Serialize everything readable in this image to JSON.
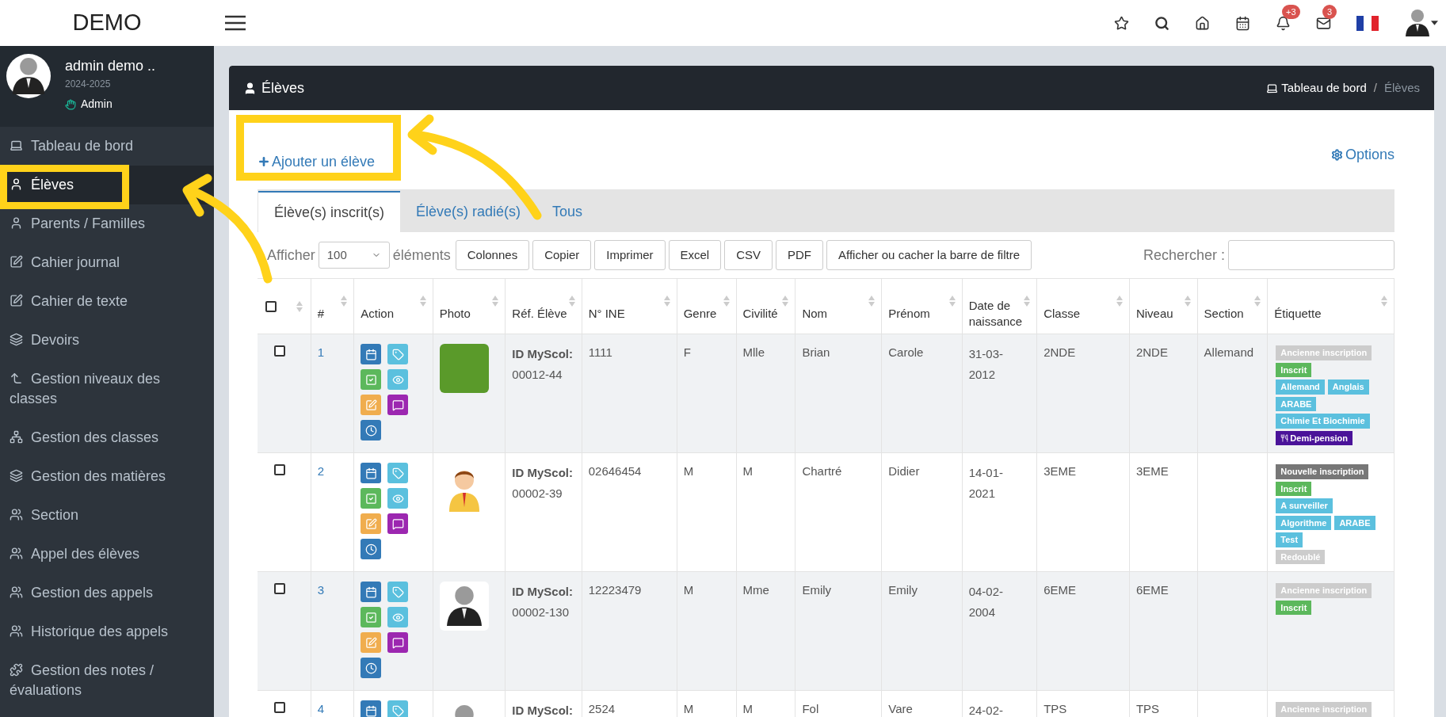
{
  "brand": "DEMO",
  "topbar": {
    "notifications_badge": "+3",
    "messages_badge": "3"
  },
  "profile": {
    "name": "admin demo ..",
    "year": "2024-2025",
    "role": "Admin"
  },
  "sidebar": {
    "items": [
      {
        "label": "Tableau de bord",
        "selected": false
      },
      {
        "label": "Élèves",
        "selected": true
      },
      {
        "label": "Parents / Familles",
        "selected": false
      },
      {
        "label": "Cahier journal",
        "selected": false
      },
      {
        "label": "Cahier de texte",
        "selected": false
      },
      {
        "label": "Devoirs",
        "selected": false
      },
      {
        "label": "Gestion niveaux des classes",
        "selected": false
      },
      {
        "label": "Gestion des classes",
        "selected": false
      },
      {
        "label": "Gestion des matières",
        "selected": false
      },
      {
        "label": "Section",
        "selected": false
      },
      {
        "label": "Appel des élèves",
        "selected": false
      },
      {
        "label": "Gestion des appels",
        "selected": false
      },
      {
        "label": "Historique des appels",
        "selected": false
      },
      {
        "label": "Gestion des notes / évaluations",
        "selected": false
      }
    ]
  },
  "page": {
    "title": "Élèves",
    "breadcrumb": [
      "Tableau de bord",
      "Élèves"
    ],
    "breadcrumb_separator": "/"
  },
  "add_button": "Ajouter un élève",
  "options_link": "Options",
  "tabs": [
    {
      "label": "Élève(s) inscrit(s)",
      "selected": true
    },
    {
      "label": "Élève(s) radié(s)",
      "selected": false
    },
    {
      "label": "Tous",
      "selected": false
    }
  ],
  "length_control": {
    "label_before": "Afficher",
    "value": "100",
    "label_after": "éléments"
  },
  "export_buttons": [
    "Colonnes",
    "Copier",
    "Imprimer",
    "Excel",
    "CSV",
    "PDF",
    "Afficher ou cacher la barre de filtre"
  ],
  "search": {
    "label": "Rechercher :"
  },
  "table": {
    "select_all_checked": false,
    "columns": [
      "#",
      "Action",
      "Photo",
      "Réf. Élève",
      "N° INE",
      "Genre",
      "Civilité",
      "Nom",
      "Prénom",
      "Date de naissance",
      "Classe",
      "Niveau",
      "Section",
      "Étiquette"
    ],
    "rows": [
      {
        "checked": false,
        "number": "1",
        "photo": {
          "kind": "photo"
        },
        "ref_label": "ID MyScol:",
        "ref": "00012-44",
        "ine": "1111",
        "genre": "F",
        "civilite": "Mlle",
        "nom": "Brian",
        "prenom": "Carole",
        "date": "31-03-2012",
        "classe": "2NDE",
        "niveau": "2NDE",
        "section": "Allemand",
        "tags": [
          [
            {
              "label": "Ancienne inscription",
              "color": "#cccccc"
            }
          ],
          [
            {
              "label": "Inscrit",
              "color": "#5cb85c"
            }
          ],
          [
            {
              "label": "Allemand",
              "color": "#5bc0de"
            },
            {
              "label": "Anglais",
              "color": "#5bc0de"
            }
          ],
          [
            {
              "label": "ARABE",
              "color": "#5bc0de"
            }
          ],
          [
            {
              "label": "Chimie Et Biochimie",
              "color": "#5bc0de"
            }
          ],
          [
            {
              "label": "Demi-pension",
              "color": "#4a1399",
              "kind": "meal"
            }
          ]
        ]
      },
      {
        "checked": false,
        "number": "2",
        "photo": {
          "kind": "cartoon"
        },
        "ref_label": "ID MyScol:",
        "ref": "00002-39",
        "ine": "02646454",
        "genre": "M",
        "civilite": "M",
        "nom": "Chartré",
        "prenom": "Didier",
        "date": "14-01-2021",
        "classe": "3EME",
        "niveau": "3EME",
        "section": "",
        "tags": [
          [
            {
              "label": "Nouvelle inscription",
              "color": "#777777"
            }
          ],
          [
            {
              "label": "Inscrit",
              "color": "#5cb85c"
            }
          ],
          [
            {
              "label": "A surveiller",
              "color": "#5bc0de"
            }
          ],
          [
            {
              "label": "Algorithme",
              "color": "#5bc0de"
            },
            {
              "label": "ARABE",
              "color": "#5bc0de"
            }
          ],
          [
            {
              "label": "Test",
              "color": "#5bc0de"
            }
          ],
          [
            {
              "label": "Redoublé",
              "color": "#cccccc"
            }
          ]
        ]
      },
      {
        "checked": false,
        "number": "3",
        "photo": {
          "kind": "avatar"
        },
        "ref_label": "ID MyScol:",
        "ref": "00002-130",
        "ine": "12223479",
        "genre": "M",
        "civilite": "Mme",
        "nom": "Emily",
        "prenom": "Emily",
        "date": "04-02-2004",
        "classe": "6EME",
        "niveau": "6EME",
        "section": "",
        "tags": [
          [
            {
              "label": "Ancienne inscription",
              "color": "#cccccc"
            }
          ],
          [
            {
              "label": "Inscrit",
              "color": "#5cb85c"
            }
          ]
        ]
      },
      {
        "checked": false,
        "number": "4",
        "photo": {
          "kind": "avatar"
        },
        "ref_label": "ID MyScol:",
        "ine": "2524",
        "genre": "M",
        "civilite": "M",
        "nom": "Fol",
        "prenom": "Vare",
        "date": "24-02-",
        "classe": "TPS",
        "niveau": "TPS",
        "section": "",
        "tags": [
          [
            {
              "label": "Ancienne inscription",
              "color": "#cccccc"
            }
          ]
        ]
      }
    ]
  }
}
